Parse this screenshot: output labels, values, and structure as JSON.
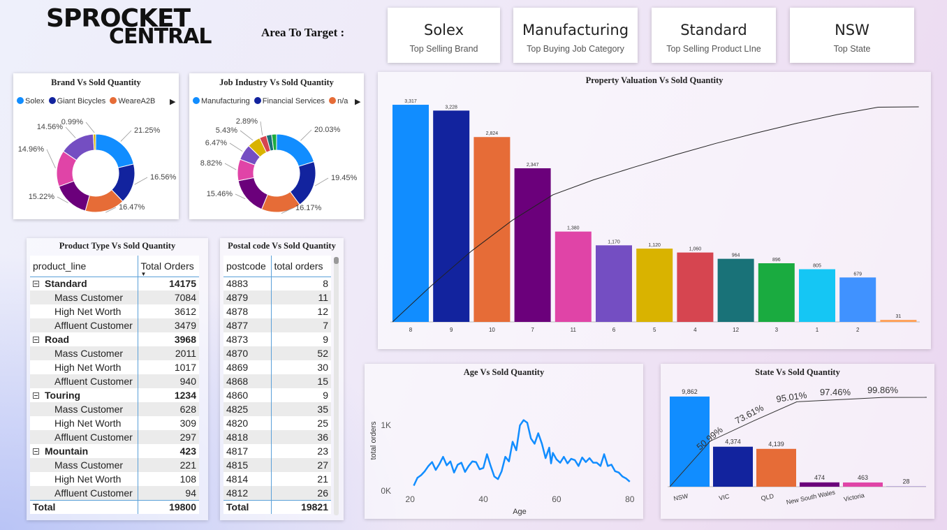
{
  "logo": {
    "line1": "SPROCKET",
    "line2": "CENTRAL"
  },
  "target_label": "Area To Target :",
  "kpis": [
    {
      "value": "Solex",
      "caption": "Top Selling Brand"
    },
    {
      "value": "Manufacturing",
      "caption": "Top Buying Job Category"
    },
    {
      "value": "Standard",
      "caption": "Top Selling Product LIne"
    },
    {
      "value": "NSW",
      "caption": "Top State"
    }
  ],
  "brand_panel": {
    "title": "Brand Vs Sold Quantity",
    "legend": [
      "Solex",
      "Giant Bicycles",
      "WeareA2B"
    ]
  },
  "job_panel": {
    "title": "Job Industry Vs Sold Quantity",
    "legend": [
      "Manufacturing",
      "Financial Services",
      "n/a"
    ]
  },
  "property_panel": {
    "title": "Property Valuation Vs Sold Quantity"
  },
  "age_panel": {
    "title": "Age Vs Sold Quantity"
  },
  "state_panel": {
    "title": "State Vs Sold Quantity"
  },
  "product_table": {
    "title": "Product Type Vs Sold Quantity",
    "col1": "product_line",
    "col2": "Total Orders",
    "groups": [
      {
        "name": "Standard",
        "total": "14175",
        "rows": [
          [
            "Mass Customer",
            "7084"
          ],
          [
            "High Net Worth",
            "3612"
          ],
          [
            "Affluent Customer",
            "3479"
          ]
        ]
      },
      {
        "name": "Road",
        "total": "3968",
        "rows": [
          [
            "Mass Customer",
            "2011"
          ],
          [
            "High Net Worth",
            "1017"
          ],
          [
            "Affluent Customer",
            "940"
          ]
        ]
      },
      {
        "name": "Touring",
        "total": "1234",
        "rows": [
          [
            "Mass Customer",
            "628"
          ],
          [
            "High Net Worth",
            "309"
          ],
          [
            "Affluent Customer",
            "297"
          ]
        ]
      },
      {
        "name": "Mountain",
        "total": "423",
        "rows": [
          [
            "Mass Customer",
            "221"
          ],
          [
            "High Net Worth",
            "108"
          ],
          [
            "Affluent Customer",
            "94"
          ]
        ]
      }
    ],
    "total_label": "Total",
    "total_value": "19800"
  },
  "postal_table": {
    "title": "Postal code Vs Sold Quantity",
    "col1": "postcode",
    "col2": "total orders",
    "rows": [
      [
        "4883",
        "8"
      ],
      [
        "4879",
        "11"
      ],
      [
        "4878",
        "12"
      ],
      [
        "4877",
        "7"
      ],
      [
        "4873",
        "9"
      ],
      [
        "4870",
        "52"
      ],
      [
        "4869",
        "30"
      ],
      [
        "4868",
        "15"
      ],
      [
        "4860",
        "9"
      ],
      [
        "4825",
        "35"
      ],
      [
        "4820",
        "25"
      ],
      [
        "4818",
        "36"
      ],
      [
        "4817",
        "23"
      ],
      [
        "4815",
        "27"
      ],
      [
        "4814",
        "21"
      ],
      [
        "4812",
        "26"
      ]
    ],
    "total_label": "Total",
    "total_value": "19821"
  },
  "chart_data": [
    {
      "type": "pie",
      "title": "Brand Vs Sold Quantity",
      "donut": true,
      "legend": [
        "Solex",
        "Giant Bicycles",
        "WeareA2B"
      ],
      "slices": [
        {
          "name": "Solex",
          "value": 21.25,
          "label": "21.25%",
          "color": "#118DFF"
        },
        {
          "name": "Giant Bicycles",
          "value": 16.56,
          "label": "16.56%",
          "color": "#12239E"
        },
        {
          "name": "WeareA2B",
          "value": 16.47,
          "label": "16.47%",
          "color": "#E66C37"
        },
        {
          "name": "",
          "value": 15.22,
          "label": "15.22%",
          "color": "#6B007B"
        },
        {
          "name": "",
          "value": 14.96,
          "label": "14.96%",
          "color": "#E044A7"
        },
        {
          "name": "",
          "value": 14.56,
          "label": "14.56%",
          "color": "#744EC2"
        },
        {
          "name": "",
          "value": 0.99,
          "label": "0.99%",
          "color": "#D9B300"
        }
      ]
    },
    {
      "type": "pie",
      "title": "Job Industry Vs Sold Quantity",
      "donut": true,
      "legend": [
        "Manufacturing",
        "Financial Services",
        "n/a"
      ],
      "slices": [
        {
          "name": "Manufacturing",
          "value": 20.03,
          "label": "20.03%",
          "color": "#118DFF"
        },
        {
          "name": "Financial Services",
          "value": 19.45,
          "label": "19.45%",
          "color": "#12239E"
        },
        {
          "name": "n/a",
          "value": 16.17,
          "label": "16.17%",
          "color": "#E66C37"
        },
        {
          "name": "",
          "value": 15.46,
          "label": "15.46%",
          "color": "#6B007B"
        },
        {
          "name": "",
          "value": 8.82,
          "label": "8.82%",
          "color": "#E044A7"
        },
        {
          "name": "",
          "value": 6.47,
          "label": "6.47%",
          "color": "#744EC2"
        },
        {
          "name": "",
          "value": 5.43,
          "label": "5.43%",
          "color": "#D9B300"
        },
        {
          "name": "",
          "value": 2.89,
          "label": "2.89%",
          "color": "#D64550"
        },
        {
          "name": "",
          "value": 2.2,
          "label": "",
          "color": "#197278"
        },
        {
          "name": "",
          "value": 2.0,
          "label": "",
          "color": "#1AAB40"
        }
      ]
    },
    {
      "type": "bar",
      "title": "Property Valuation Vs Sold Quantity",
      "pareto": true,
      "categories": [
        "8",
        "9",
        "10",
        "7",
        "11",
        "6",
        "5",
        "4",
        "12",
        "3",
        "1",
        "2",
        ""
      ],
      "values": [
        3317,
        3228,
        2824,
        2347,
        1380,
        1170,
        1120,
        1060,
        964,
        896,
        805,
        679,
        31
      ],
      "labels": [
        "3,317",
        "3,228",
        "2,824",
        "2,347",
        "1,380",
        "1,170",
        "1,120",
        "1,060",
        "964",
        "896",
        "805",
        "679",
        "31"
      ],
      "colors": [
        "#118DFF",
        "#12239E",
        "#E66C37",
        "#6B007B",
        "#E044A7",
        "#744EC2",
        "#D9B300",
        "#D64550",
        "#197278",
        "#1AAB40",
        "#15C6F4",
        "#4092FF",
        "#FFA058"
      ],
      "ylim": [
        0,
        3500
      ]
    },
    {
      "type": "line",
      "title": "Age Vs Sold Quantity",
      "xlabel": "Age",
      "ylabel": "total orders",
      "xticks": [
        "20",
        "40",
        "60",
        "80"
      ],
      "yticks": [
        "0K",
        "1K"
      ],
      "xlim": [
        19,
        81
      ],
      "ylim": [
        0,
        1300
      ],
      "color": "#118DFF",
      "x": [
        21,
        22,
        23,
        24,
        25,
        26,
        27,
        28,
        29,
        30,
        31,
        32,
        33,
        34,
        35,
        36,
        37,
        38,
        39,
        40,
        41,
        42,
        43,
        44,
        45,
        46,
        47,
        48,
        49,
        50,
        51,
        52,
        53,
        54,
        55,
        56,
        57,
        58,
        58.5,
        59,
        60,
        61,
        62,
        63,
        64,
        65,
        66,
        67,
        68,
        69,
        70,
        71,
        72,
        73,
        74,
        75,
        76,
        77,
        78,
        79,
        80
      ],
      "y": [
        80,
        200,
        240,
        300,
        380,
        440,
        320,
        410,
        520,
        390,
        450,
        280,
        400,
        430,
        290,
        380,
        450,
        440,
        330,
        350,
        560,
        380,
        220,
        180,
        300,
        520,
        450,
        750,
        620,
        1000,
        1080,
        1040,
        800,
        720,
        880,
        720,
        500,
        660,
        420,
        580,
        480,
        430,
        520,
        420,
        490,
        470,
        380,
        510,
        440,
        500,
        430,
        430,
        380,
        560,
        380,
        400,
        300,
        280,
        220,
        190,
        140
      ]
    },
    {
      "type": "bar",
      "title": "State Vs Sold Quantity",
      "pareto": true,
      "categories": [
        "NSW",
        "VIC",
        "QLD",
        "New South Wales",
        "Victoria",
        ""
      ],
      "values": [
        9862,
        4374,
        4139,
        474,
        463,
        28
      ],
      "labels": [
        "9,862",
        "4,374",
        "4,139",
        "474",
        "463",
        "28"
      ],
      "colors": [
        "#118DFF",
        "#12239E",
        "#E66C37",
        "#6B007B",
        "#E044A7",
        "#744EC2"
      ],
      "cumulative_labels": [
        "50.99%",
        "73.61%",
        "95.01%",
        "97.46%",
        "99.86%"
      ],
      "ylim": [
        0,
        10000
      ]
    }
  ]
}
